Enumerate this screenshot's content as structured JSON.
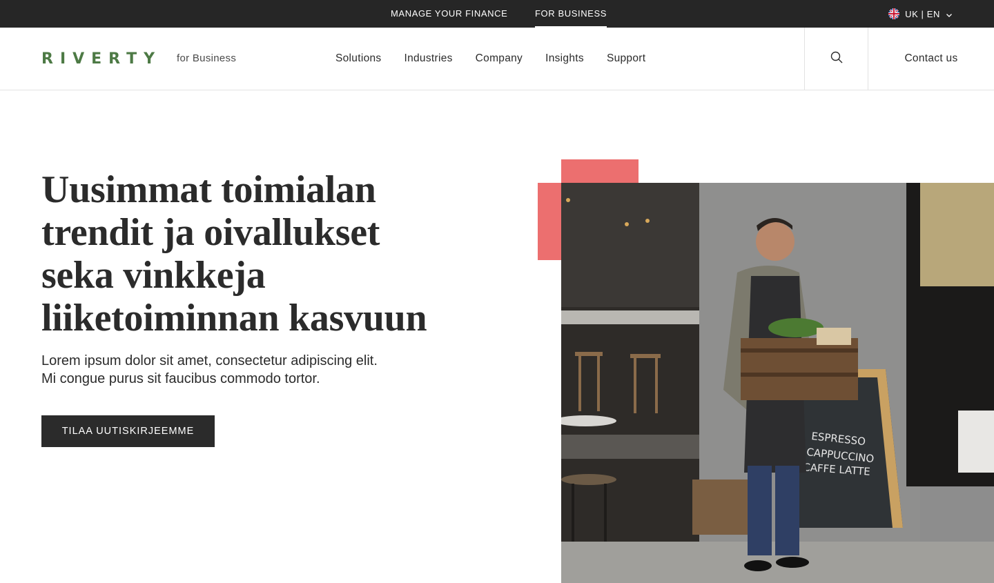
{
  "topbar": {
    "tabs": [
      {
        "label": "MANAGE YOUR FINANCE",
        "active": false
      },
      {
        "label": "FOR BUSINESS",
        "active": true
      }
    ],
    "locale": "UK | EN",
    "locale_icon": "uk-flag-icon"
  },
  "header": {
    "logo": "RIVERTY",
    "subtitle": "for Business",
    "nav": [
      "Solutions",
      "Industries",
      "Company",
      "Insights",
      "Support"
    ],
    "contact_label": "Contact us",
    "search_icon": "search-icon"
  },
  "hero": {
    "title_lines": [
      "Uusimmat toimialan",
      "trendit ja oivallukset",
      "seka vinkkeja",
      "liiketoiminnan kasvuun"
    ],
    "subtitle_lines": [
      "Lorem ipsum dolor sit amet, consectetur adipiscing elit.",
      "Mi congue purus sit faucibus commodo tortor."
    ],
    "cta_label": "TILAA UUTISKIRJEEMME",
    "sign_lines": [
      "ESPRESSO",
      "CAPPUCCINO",
      "CAFFE LATTE"
    ]
  },
  "colors": {
    "brand_green": "#4d7a45",
    "accent_coral": "#ec6f6f",
    "dark": "#262626"
  }
}
